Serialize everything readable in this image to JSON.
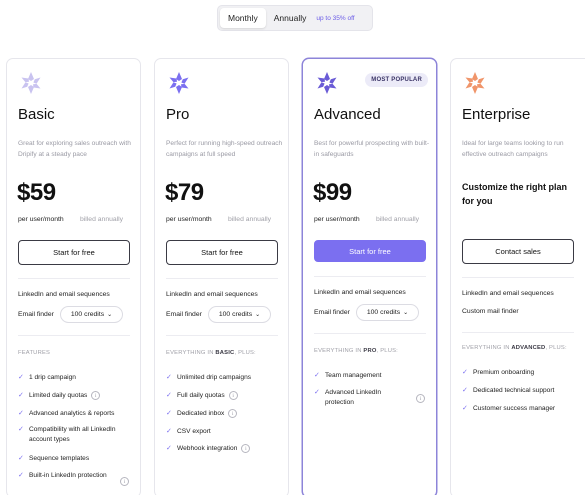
{
  "billing": {
    "monthly": "Monthly",
    "annually": "Annually",
    "save": "up to 35% off"
  },
  "plans": [
    {
      "name": "Basic",
      "desc": "Great for exploring sales outreach with Dripify at a steady pace",
      "price": "$59",
      "per": "per user/month",
      "billed": "billed annually",
      "cta": "Start for free",
      "line1": "LinkedIn and email sequences",
      "line2": "Email finder",
      "credits": "100 credits",
      "section": "FEATURES",
      "features": [
        "1 drip campaign",
        "Limited daily quotas",
        "Advanced analytics & reports",
        "Compatibility with all LinkedIn account types",
        "Sequence templates",
        "Built-in LinkedIn protection"
      ],
      "logo_color": "#c9c3f0"
    },
    {
      "name": "Pro",
      "desc": "Perfect for running high-speed outreach campaigns at full speed",
      "price": "$79",
      "per": "per user/month",
      "billed": "billed annually",
      "cta": "Start for free",
      "line1": "LinkedIn and email sequences",
      "line2": "Email finder",
      "credits": "100 credits",
      "section_pre": "EVERYTHING IN ",
      "section_bold": "BASIC",
      "section_post": ", PLUS:",
      "features": [
        "Unlimited drip campaigns",
        "Full daily quotas",
        "Dedicated inbox",
        "CSV export",
        "Webhook integration"
      ],
      "logo_color": "#7b6ff0"
    },
    {
      "name": "Advanced",
      "badge": "MOST POPULAR",
      "desc": "Best for powerful prospecting with built-in safeguards",
      "price": "$99",
      "per": "per user/month",
      "billed": "billed annually",
      "cta": "Start for free",
      "line1": "LinkedIn and email sequences",
      "line2": "Email finder",
      "credits": "100 credits",
      "section_pre": "EVERYTHING IN ",
      "section_bold": "PRO",
      "section_post": ", PLUS:",
      "features": [
        "Team management",
        "Advanced LinkedIn protection"
      ],
      "logo_color": "#6a5bd6"
    },
    {
      "name": "Enterprise",
      "desc": "Ideal for large teams looking to run effective outreach campaigns",
      "custom": "Customize the right plan for you",
      "cta": "Contact sales",
      "line1": "LinkedIn and email sequences",
      "line2": "Custom mail finder",
      "section_pre": "EVERYTHING IN ",
      "section_bold": "ADVANCED",
      "section_post": ", PLUS:",
      "features": [
        "Premium onboarding",
        "Dedicated technical support",
        "Customer success manager"
      ],
      "logo_color": "#f0956a"
    }
  ]
}
